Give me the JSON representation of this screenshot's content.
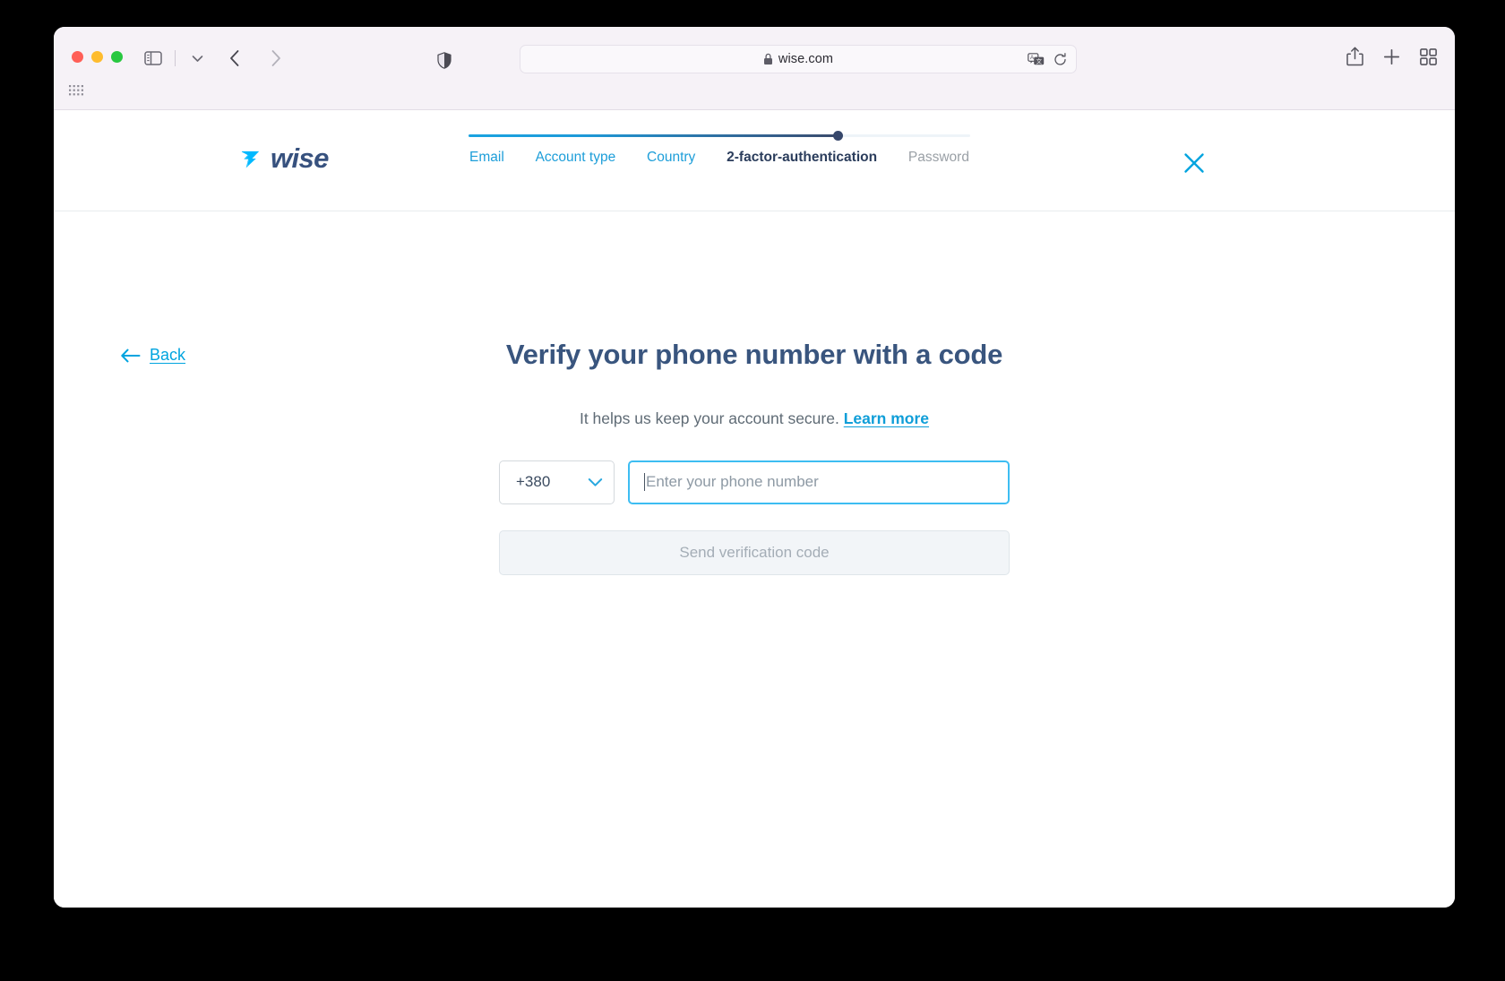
{
  "browser": {
    "url": "wise.com",
    "lock_icon": "lock-icon",
    "sidebar_icon": "sidebar-toggle-icon",
    "chevron_icon": "chevron-down-icon",
    "back_icon": "back-arrow-icon",
    "forward_icon": "forward-arrow-icon",
    "shield_icon": "privacy-shield-icon",
    "translate_icon": "translate-icon",
    "reload_icon": "reload-icon",
    "share_icon": "share-icon",
    "newtab_icon": "plus-icon",
    "tabs_icon": "tab-overview-icon",
    "apps_icon": "apps-grid-icon",
    "traffic_lights": {
      "close": "#ff5f57",
      "minimize": "#febc2e",
      "maximize": "#28c840"
    }
  },
  "header": {
    "brand": "wise",
    "brand_mark_icon": "wise-arrow-logo",
    "close_label": "close-icon",
    "stepper": {
      "progress_percent": 73.5,
      "steps": [
        {
          "label": "Email",
          "state": "done"
        },
        {
          "label": "Account type",
          "state": "done"
        },
        {
          "label": "Country",
          "state": "done"
        },
        {
          "label": "2-factor-authentication",
          "state": "current"
        },
        {
          "label": "Password",
          "state": "future"
        }
      ]
    }
  },
  "content": {
    "back_label": "Back",
    "back_icon": "arrow-left-icon",
    "headline": "Verify your phone number with a code",
    "subline_text": "It helps us keep your account secure.",
    "subline_link": "Learn more",
    "country_code": "+380",
    "country_chevron_icon": "chevron-down-icon",
    "phone_placeholder": "Enter your phone number",
    "phone_value": "",
    "submit_label": "Send verification code"
  },
  "colors": {
    "brand_blue": "#00a4df",
    "brand_navy": "#37517e",
    "link_blue": "#0f9ed8",
    "focus_border": "#3dbdf2",
    "disabled_bg": "#f2f5f8"
  }
}
